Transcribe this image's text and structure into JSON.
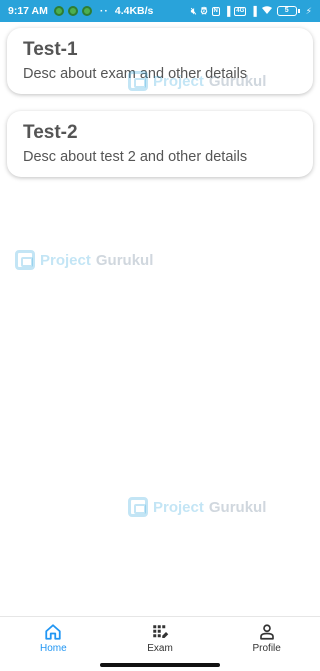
{
  "status_bar": {
    "time": "9:17 AM",
    "dots": "··",
    "speed": "4.4KB/s",
    "battery_level": "5",
    "colors": {
      "background": "#29a3da"
    }
  },
  "cards": [
    {
      "title": "Test-1",
      "description": "Desc about exam and other details"
    },
    {
      "title": "Test-2",
      "description": "Desc about test 2 and other details"
    }
  ],
  "watermark": {
    "word1": "Project",
    "word2": "Gurukul"
  },
  "bottom_nav": {
    "items": [
      {
        "label": "Home",
        "icon": "home-icon",
        "active": true
      },
      {
        "label": "Exam",
        "icon": "exam-icon",
        "active": false
      },
      {
        "label": "Profile",
        "icon": "profile-icon",
        "active": false
      }
    ],
    "active_color": "#2196f3"
  }
}
